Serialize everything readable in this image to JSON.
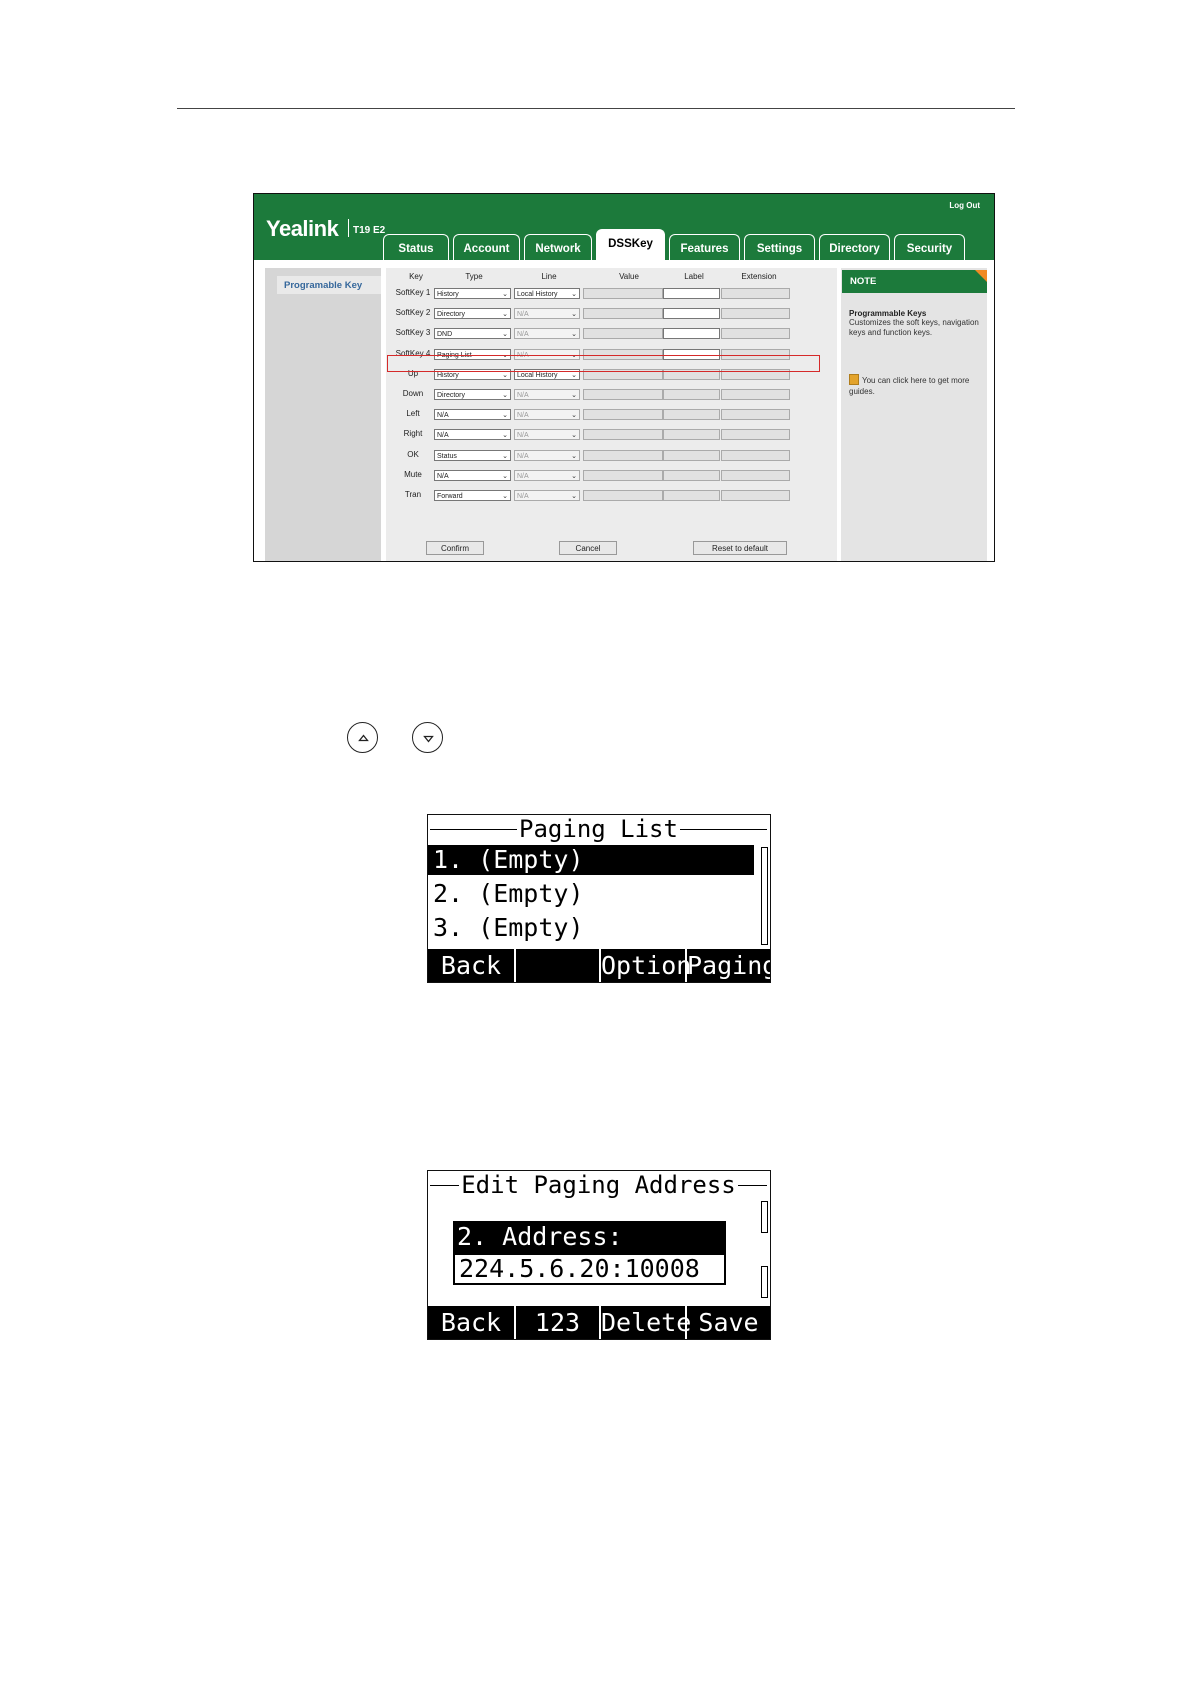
{
  "webui": {
    "brand": "Yealink",
    "model": "T19 E2",
    "logout": "Log Out",
    "tabs": [
      "Status",
      "Account",
      "Network",
      "DSSKey",
      "Features",
      "Settings",
      "Directory",
      "Security"
    ],
    "active_tab": "DSSKey",
    "left_nav": [
      "Programable Key"
    ],
    "columns": [
      "Key",
      "Type",
      "Line",
      "Value",
      "Label",
      "Extension"
    ],
    "rows": [
      {
        "key": "SoftKey 1",
        "type": "History",
        "line": "Local History"
      },
      {
        "key": "SoftKey 2",
        "type": "Directory",
        "line": "N/A"
      },
      {
        "key": "SoftKey 3",
        "type": "DND",
        "line": "N/A"
      },
      {
        "key": "SoftKey 4",
        "type": "Paging List",
        "line": "N/A"
      },
      {
        "key": "Up",
        "type": "History",
        "line": "Local History"
      },
      {
        "key": "Down",
        "type": "Directory",
        "line": "N/A"
      },
      {
        "key": "Left",
        "type": "N/A",
        "line": "N/A"
      },
      {
        "key": "Right",
        "type": "N/A",
        "line": "N/A"
      },
      {
        "key": "OK",
        "type": "Status",
        "line": "N/A"
      },
      {
        "key": "Mute",
        "type": "N/A",
        "line": "N/A"
      },
      {
        "key": "Tran",
        "type": "Forward",
        "line": "N/A"
      }
    ],
    "buttons": {
      "confirm": "Confirm",
      "cancel": "Cancel",
      "reset": "Reset to default"
    },
    "note": {
      "header": "NOTE",
      "title": "Programmable Keys",
      "body": "Customizes the soft keys, navigation keys and function keys.",
      "link": "You can click here to get more guides."
    }
  },
  "lcd1": {
    "title": "Paging List",
    "items": [
      "1. (Empty)",
      "2. (Empty)",
      "3. (Empty)"
    ],
    "softkeys": [
      "Back",
      "",
      "Option",
      "Paging"
    ]
  },
  "lcd2": {
    "title": "Edit Paging Address",
    "label": "2.  Address:",
    "value": "224.5.6.20:10008",
    "softkeys": [
      "Back",
      "123",
      "Delete",
      "Save"
    ]
  },
  "colors": {
    "brand_green": "#1c7a3b",
    "highlight_red": "#d52a2a",
    "note_orange": "#f08a24"
  },
  "icons": [
    "up-navigation-key-icon",
    "down-navigation-key-icon"
  ]
}
